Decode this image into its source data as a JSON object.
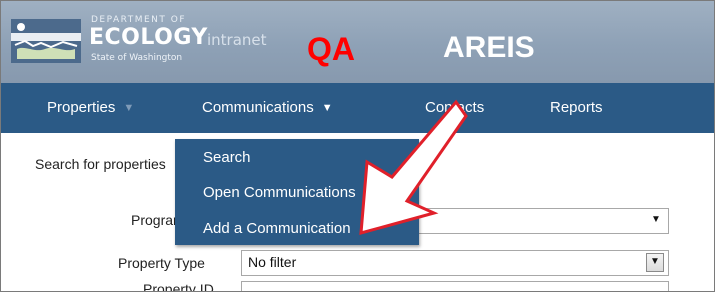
{
  "header": {
    "dept_line": "DEPARTMENT OF",
    "ecology": "ECOLOGY",
    "intranet": "intranet",
    "state": "State of Washington",
    "env_badge": "QA",
    "app_title": "AREIS"
  },
  "nav": {
    "items": [
      {
        "label": "Properties"
      },
      {
        "label": "Communications"
      },
      {
        "label": "Contacts"
      },
      {
        "label": "Reports"
      }
    ]
  },
  "dropdown": {
    "items": [
      {
        "label": "Search"
      },
      {
        "label": "Open Communications"
      },
      {
        "label": "Add a Communication"
      }
    ]
  },
  "form": {
    "search_label": "Search for properties",
    "program_label": "Program",
    "program_value": "",
    "property_type_label": "Property Type",
    "property_type_value": "No filter",
    "property_id_label": "Property ID"
  },
  "colors": {
    "nav_bg": "#2b5a86",
    "header_bg": "#8ea1b6",
    "env_badge": "#ff0000",
    "annotation_arrow": "#e0202a"
  }
}
